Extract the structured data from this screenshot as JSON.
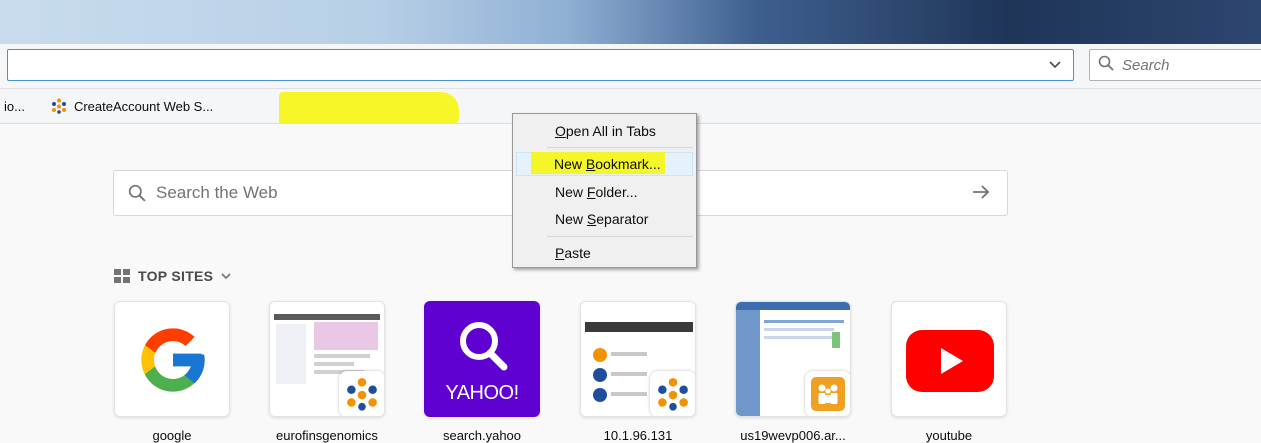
{
  "search": {
    "placeholder": "Search"
  },
  "bookmarks": [
    {
      "label": "io..."
    },
    {
      "label": "CreateAccount Web S..."
    }
  ],
  "newtab": {
    "web_search_placeholder": "Search the Web",
    "top_sites_heading": "TOP SITES",
    "tiles": [
      {
        "label": "google"
      },
      {
        "label": "eurofinsgenomics"
      },
      {
        "label": "search.yahoo",
        "logo_text": "YAHOO!"
      },
      {
        "label": "10.1.96.131"
      },
      {
        "label": "us19wevp006.ar..."
      },
      {
        "label": "youtube"
      }
    ]
  },
  "context_menu": {
    "items": [
      {
        "accel": "O",
        "rest": "pen All in Tabs"
      },
      {
        "pre": "New ",
        "accel": "B",
        "rest": "ookmark..."
      },
      {
        "pre": "New ",
        "accel": "F",
        "rest": "older..."
      },
      {
        "pre": "New ",
        "accel": "S",
        "rest": "eparator"
      },
      {
        "accel": "P",
        "rest": "aste"
      }
    ],
    "hovered_item": "New Bookmark..."
  },
  "colors": {
    "highlight": "#f5f51e",
    "url_focus": "#4a90d9",
    "yahoo": "#5f01d1",
    "youtube": "#ff0000"
  }
}
